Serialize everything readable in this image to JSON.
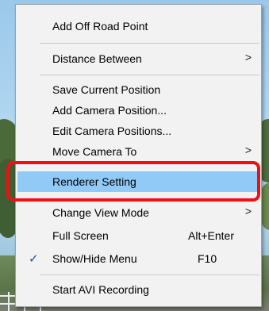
{
  "menu": {
    "items": [
      {
        "label": "Add Off Road Point"
      },
      {
        "label": "Distance Between",
        "submenu": true
      },
      {
        "label": "Save Current Position"
      },
      {
        "label": "Add Camera Position..."
      },
      {
        "label": "Edit Camera Positions..."
      },
      {
        "label": "Move Camera To",
        "submenu": true
      },
      {
        "label": "Renderer Setting",
        "highlighted": true
      },
      {
        "label": "Change View Mode",
        "submenu": true
      },
      {
        "label": "Full Screen",
        "accelerator": "Alt+Enter"
      },
      {
        "label": "Show/Hide Menu",
        "accelerator": "F10",
        "checked": true
      },
      {
        "label": "Start AVI Recording"
      }
    ],
    "submenu_arrow": ">",
    "check_mark": "✓"
  },
  "colors": {
    "highlight": "#91c9f7",
    "callout_border": "#ee1111",
    "menu_bg": "#f2f2f2"
  },
  "icons": [
    "chevron-right-icon",
    "checkmark-icon"
  ]
}
